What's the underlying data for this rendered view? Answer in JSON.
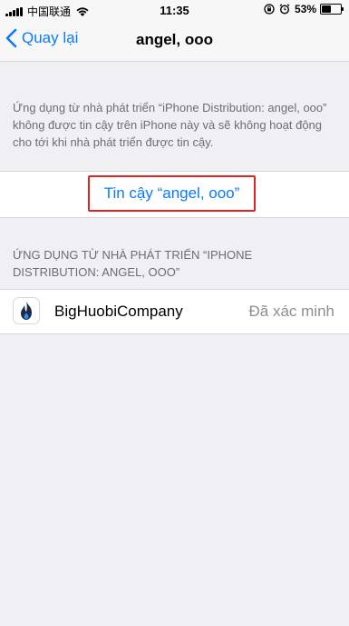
{
  "status_bar": {
    "carrier": "中国联通",
    "time": "11:35",
    "battery_percent": "53%",
    "battery_level": 0.53,
    "icons": [
      "signal-icon",
      "wifi-icon",
      "rotation-lock-icon",
      "alarm-icon",
      "battery-icon"
    ]
  },
  "navbar": {
    "back_label": "Quay lại",
    "title": "angel, ooo"
  },
  "explanation": "Ứng dụng từ nhà phát triển “iPhone Distribution: angel, ooo” không được tin cậy trên iPhone này và sẽ không hoạt động cho tới khi nhà phát triển được tin cậy.",
  "trust_button_label": "Tin cậy “angel, ooo”",
  "section": {
    "header": "ỨNG DỤNG TỪ NHÀ PHÁT TRIỂN “IPHONE DISTRIBUTION: ANGEL, OOO”"
  },
  "apps": [
    {
      "name": "BigHuobiCompany",
      "status": "Đã xác minh",
      "icon": "huobi-flame-icon"
    }
  ],
  "colors": {
    "accent": "#0a7aff",
    "highlight_border": "#e02424",
    "background": "#efeff4",
    "secondary_text": "#6d6d72"
  }
}
